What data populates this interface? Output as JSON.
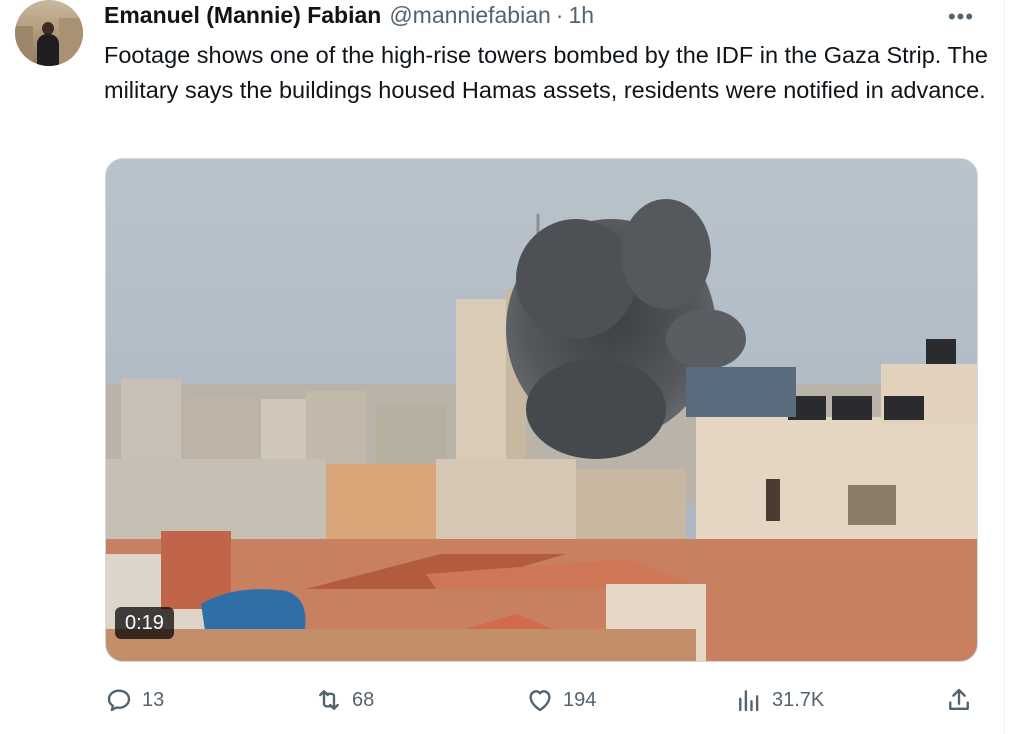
{
  "tweet": {
    "author_name": "Emanuel (Mannie) Fabian",
    "handle": "@manniefabian",
    "separator": "·",
    "time": "1h",
    "more_label": "•••",
    "text": "Footage shows one of the high-rise towers bombed by the IDF in the Gaza Strip. The military says the buildings housed Hamas assets, residents were notified in advance."
  },
  "media": {
    "type": "video",
    "duration": "0:19"
  },
  "actions": {
    "replies": "13",
    "retweets": "68",
    "likes": "194",
    "views": "31.7K"
  },
  "icons": {
    "reply": "reply-icon",
    "retweet": "retweet-icon",
    "like": "heart-icon",
    "views": "views-chart-icon",
    "share": "share-icon",
    "more": "more-dots-icon"
  },
  "colors": {
    "text_primary": "#0f1419",
    "text_secondary": "#536471",
    "border": "#cfd9de"
  }
}
